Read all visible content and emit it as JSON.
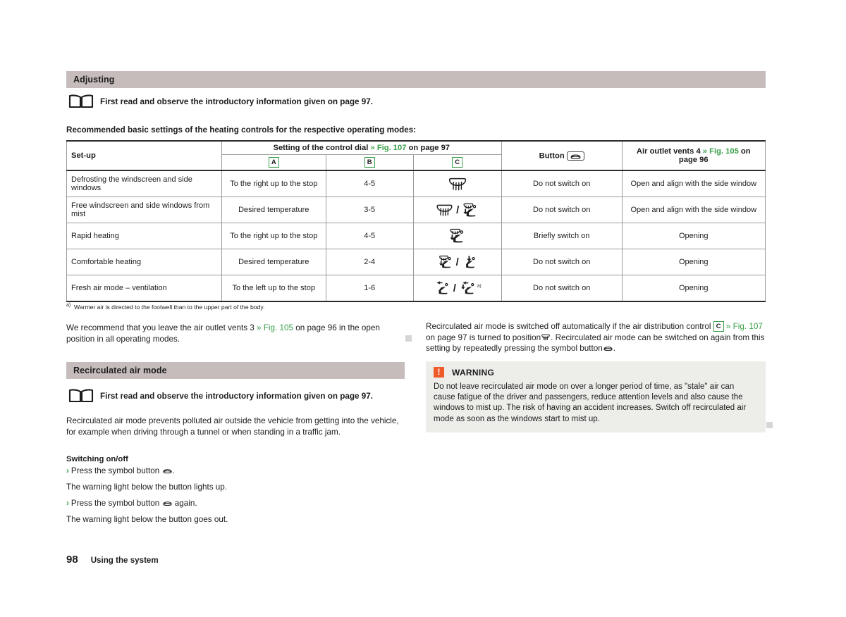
{
  "page": {
    "number": "98",
    "chapter": "Using the system"
  },
  "sections": {
    "adjusting": {
      "title": "Adjusting",
      "note": "First read and observe the introductory information given on page 97.",
      "intro": "Recommended basic settings of the heating controls for the respective operating modes:"
    },
    "recirculated": {
      "title": "Recirculated air mode",
      "note": "First read and observe the introductory information given on page 97.",
      "body": "Recirculated air mode prevents polluted air outside the vehicle from getting into the vehicle, for example when driving through a tunnel or when standing in a traffic jam.",
      "subhead": "Switching on/off",
      "step_1_pre": "Press the symbol button",
      "step_1_post": ".",
      "result_1": "The warning light below the button lights up.",
      "step_2_pre": "Press the symbol button",
      "step_2_post": "again.",
      "result_2": "The warning light below the button goes out."
    }
  },
  "table": {
    "headers": {
      "setup": "Set-up",
      "dial_pre": "Setting of the control dial",
      "dial_ref": "» Fig. 107",
      "dial_post": "on page 97",
      "col_a": "A",
      "col_b": "B",
      "col_c": "C",
      "button": "Button",
      "vents_pre": "Air outlet vents 4",
      "vents_ref": "» Fig. 105",
      "vents_post": "on page 96"
    },
    "rows": [
      {
        "setup": "Defrosting the windscreen and side windows",
        "a": "To the right up to the stop",
        "b": "4-5",
        "symbols": [
          "windscreen"
        ],
        "button": "Do not switch on",
        "vents": "Open and align with the side window"
      },
      {
        "setup": "Free windscreen and side windows from mist",
        "a": "Desired temperature",
        "b": "3-5",
        "symbols": [
          "windscreen",
          "windscreen-footwell"
        ],
        "button": "Do not switch on",
        "vents": "Open and align with the side window"
      },
      {
        "setup": "Rapid heating",
        "a": "To the right up to the stop",
        "b": "4-5",
        "symbols": [
          "windscreen-footwell"
        ],
        "button": "Briefly switch on",
        "vents": "Opening"
      },
      {
        "setup": "Comfortable heating",
        "a": "Desired temperature",
        "b": "2-4",
        "symbols": [
          "windscreen-footwell",
          "footwell"
        ],
        "button": "Do not switch on",
        "vents": "Opening"
      },
      {
        "setup": "Fresh air mode – ventilation",
        "a": "To the left up to the stop",
        "b": "1-6",
        "symbols": [
          "upper-body",
          "upper-body-footwell"
        ],
        "footnote_mark": "a)",
        "button": "Do not switch on",
        "vents": "Opening"
      }
    ],
    "footnote_mark": "a)",
    "footnote": "Warmer air is directed to the footwell than to the upper part of the body."
  },
  "paragraphs": {
    "left_recommend_pre": "We recommend that you leave the air outlet vents 3",
    "left_recommend_ref": "» Fig. 105",
    "left_recommend_post": "on page 96 in the open position in all operating modes.",
    "right_recirc_1": "Recirculated air mode is switched off automatically if the air distribution control",
    "right_recirc_letter": "C",
    "right_recirc_ref": "» Fig. 107",
    "right_recirc_2": "on page 97 is turned to position",
    "right_recirc_3": ". Recirculated air mode can be switched on again from this setting by repeatedly pressing the symbol button",
    "right_recirc_4": "."
  },
  "warning": {
    "icon": "!",
    "title": "WARNING",
    "body": "Do not leave recirculated air mode on over a longer period of time, as \"stale\" air can cause fatigue of the driver and passengers, reduce attention levels and also cause the windows to mist up. The risk of having an accident increases. Switch off recirculated air mode as soon as the windows start to mist up."
  },
  "icons": {
    "book": "book-icon",
    "recirculation": "recirculation-icon",
    "warning": "warning-icon",
    "windscreen_defrost": "windscreen-defrost-icon",
    "footwell": "footwell-icon"
  },
  "colors": {
    "section_bar": "#c6bcbc",
    "accent_green": "#3aa04a",
    "warning_orange": "#ef5b28",
    "warning_bg": "#ededea",
    "marker_grey": "#d6d6d6"
  }
}
